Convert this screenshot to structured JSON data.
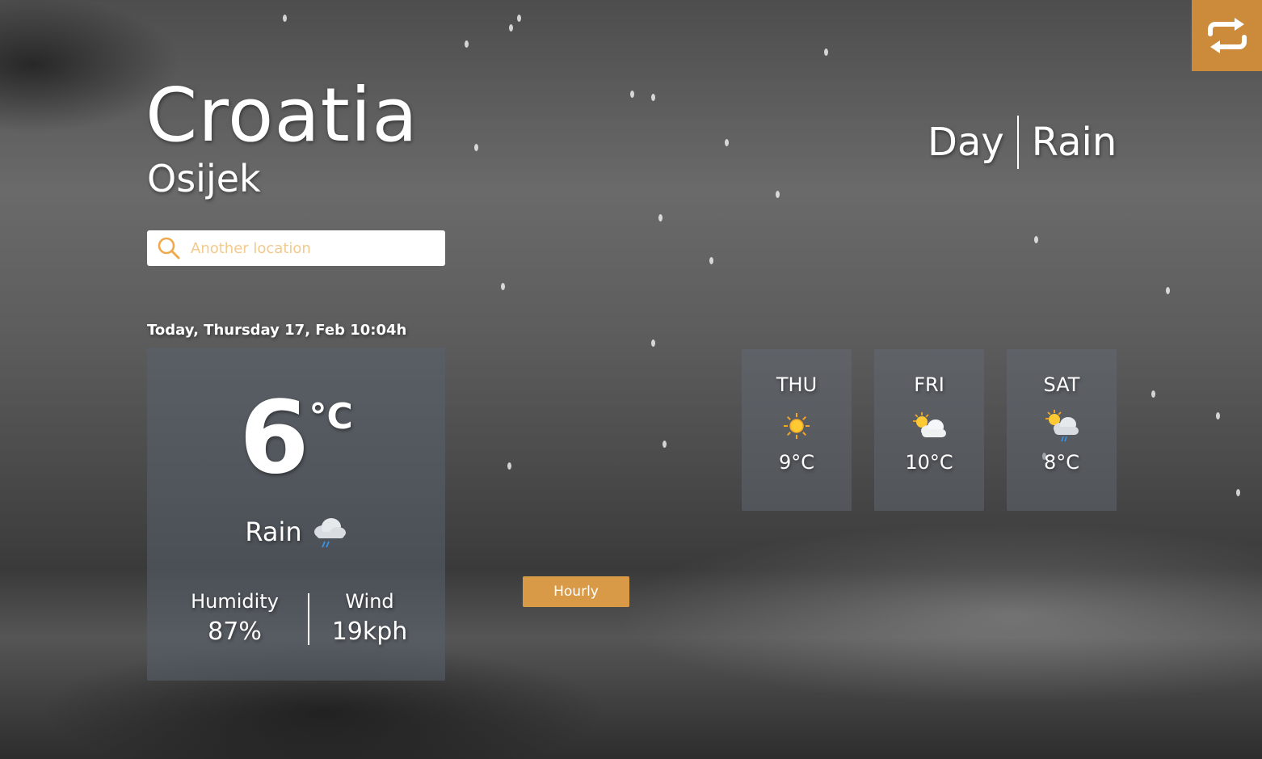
{
  "location": {
    "country": "Croatia",
    "city": "Osijek"
  },
  "search": {
    "placeholder": "Another location",
    "icon": "search-icon"
  },
  "date_label": "Today, Thursday 17, Feb 10:04h",
  "current": {
    "temperature": "6",
    "unit": "°C",
    "condition": "Rain",
    "condition_icon": "rain-cloud-icon",
    "humidity_label": "Humidity",
    "humidity_value": "87%",
    "wind_label": "Wind",
    "wind_value": "19kph"
  },
  "header": {
    "period": "Day",
    "condition": "Rain"
  },
  "forecast": [
    {
      "day": "THU",
      "icon": "sun-icon",
      "temp": "9°C"
    },
    {
      "day": "FRI",
      "icon": "partly-cloudy-icon",
      "temp": "10°C"
    },
    {
      "day": "SAT",
      "icon": "partly-cloudy-rain-icon",
      "temp": "8°C"
    }
  ],
  "buttons": {
    "hourly": "Hourly",
    "toggle_icon": "swap-arrows-icon"
  },
  "colors": {
    "accent": "#cc8a3b",
    "hourly_button": "#d99a48",
    "placeholder": "#f3c98c"
  }
}
